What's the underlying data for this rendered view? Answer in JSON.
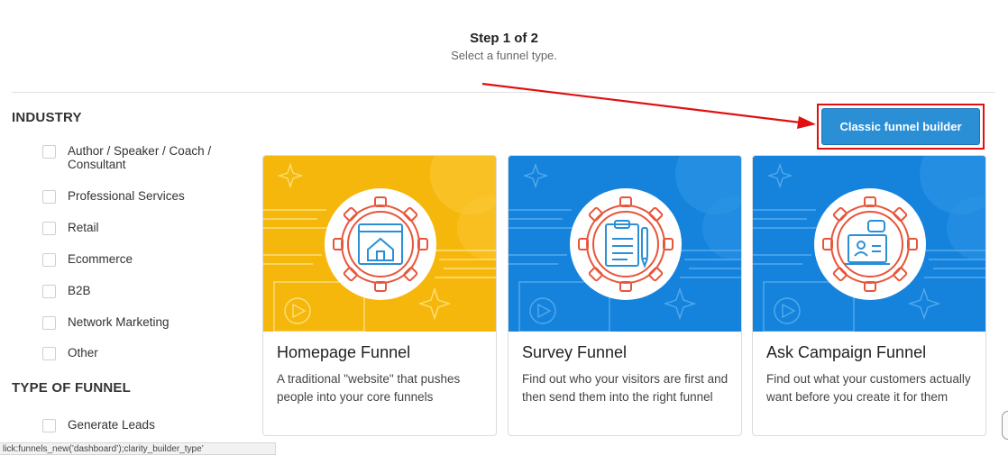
{
  "header": {
    "step": "Step 1 of 2",
    "subtitle": "Select a funnel type."
  },
  "sidebar": {
    "industry_heading": "INDUSTRY",
    "industry_items": [
      {
        "label": "Author / Speaker / Coach / Consultant",
        "checked": false
      },
      {
        "label": "Professional Services",
        "checked": false
      },
      {
        "label": "Retail",
        "checked": false
      },
      {
        "label": "Ecommerce",
        "checked": false
      },
      {
        "label": "B2B",
        "checked": false
      },
      {
        "label": "Network Marketing",
        "checked": false
      },
      {
        "label": "Other",
        "checked": false
      }
    ],
    "funnel_heading": "TYPE OF FUNNEL",
    "funnel_items": [
      {
        "label": "Generate Leads",
        "checked": false
      }
    ]
  },
  "toolbar": {
    "classic_label": "Classic funnel builder"
  },
  "cards": [
    {
      "title": "Homepage Funnel",
      "description": "A traditional \"website\" that pushes people into your core funnels",
      "icon": "homepage-icon",
      "color": "#f6b70c"
    },
    {
      "title": "Survey Funnel",
      "description": "Find out who your visitors are first and then send them into the right funnel",
      "icon": "clipboard-survey-icon",
      "color": "#1583dc"
    },
    {
      "title": "Ask Campaign Funnel",
      "description": "Find out what your customers actually want before you create it for them",
      "icon": "chat-screen-icon",
      "color": "#1583dc"
    }
  ],
  "status_bar": {
    "url": "lick:funnels_new(’dashboard’);clarity_builder_type’"
  },
  "colors": {
    "accent": "#2b8fd6",
    "highlight": "#e01010",
    "yellow": "#f6b70c",
    "blue": "#1583dc",
    "gear": "#e8553a"
  }
}
